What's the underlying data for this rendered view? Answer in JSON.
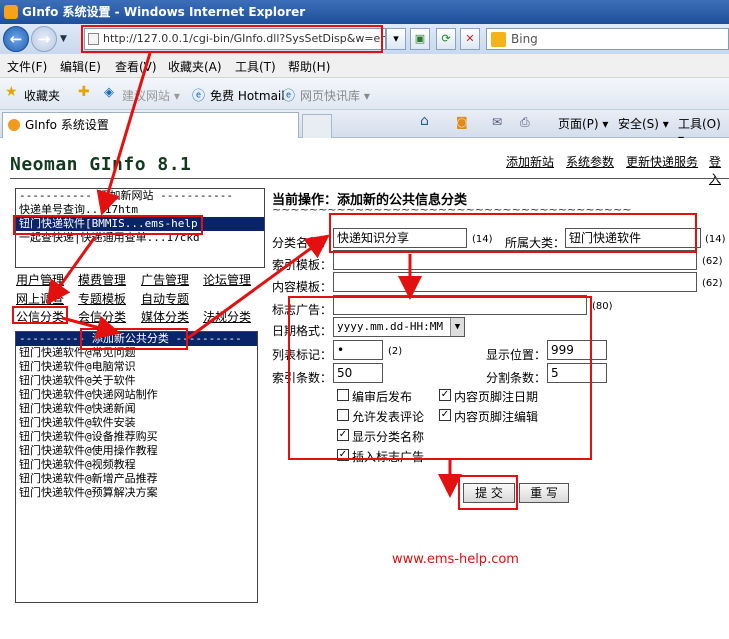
{
  "window": {
    "title": "GInfo 系统设置 - Windows Internet Explorer"
  },
  "address": {
    "url": "http://127.0.0.1/cgi-bin/GInfo.dll?SysSetDisp&w=ems-help",
    "search_placeholder": "Bing"
  },
  "menu": [
    "文件(F)",
    "编辑(E)",
    "查看(V)",
    "收藏夹(A)",
    "工具(T)",
    "帮助(H)"
  ],
  "favorites": {
    "label": "收藏夹",
    "items": [
      "建议网站 ▾",
      "免费 Hotmail",
      "网页快讯库 ▾"
    ]
  },
  "tab": {
    "title": "GInfo 系统设置"
  },
  "commands": {
    "page": "页面(P) ▾",
    "safety": "安全(S) ▾",
    "tools": "工具(O) ▾"
  },
  "brand": "Neoman GInfo 8.1",
  "top_links": [
    "添加新站",
    "系统参数",
    "更新快递服务",
    "登入"
  ],
  "site_list": [
    "----------- 添加新网站 -----------",
    "快递单号查询...17htm",
    "钮门快递软件[BMMIS...ems-help",
    "一起查快递|快递通用查单...17ckd"
  ],
  "nav_links": [
    [
      "用户管理",
      "模费管理",
      "广告管理",
      "论坛管理"
    ],
    [
      "网上调查",
      "专题模板",
      "自动专题",
      ""
    ],
    [
      "公信分类",
      "会信分类",
      "媒体分类",
      "法规分类"
    ]
  ],
  "category_list": [
    "---------- 添加新公共分类 ----------",
    "钮门快递软件@常见问题",
    "钮门快递软件@电脑常识",
    "钮门快递软件@关于软件",
    "钮门快递软件@快递网站制作",
    "钮门快递软件@快递新闻",
    "钮门快递软件@软件安装",
    "钮门快递软件@设备推荐购买",
    "钮门快递软件@使用操作教程",
    "钮门快递软件@视频教程",
    "钮门快递软件@新增产品推荐",
    "钮门快递软件@预算解决方案"
  ],
  "form": {
    "operation": "当前操作：添加新的公共信息分类",
    "tilde": "~~~~~~~~~~~~~~~~~~~~~~~~~~~~~~~~~~~~~~~",
    "name_label": "分类名称：",
    "name_value": "快递知识分享",
    "name_max": "(14)",
    "parent_label": "所属大类：",
    "parent_value": "钮门快递软件",
    "parent_max": "(14)",
    "index_tpl_label": "索引模板：",
    "index_tpl_max": "(62)",
    "content_tpl_label": "内容模板：",
    "content_tpl_max": "(62)",
    "ad_label": "标志广告：",
    "ad_max": "(80)",
    "date_label": "日期格式：",
    "date_value": "yyyy.mm.dd-HH:MM",
    "mark_label": "列表标记：",
    "mark_value": "•",
    "mark_max": "(2)",
    "position_label": "显示位置：",
    "position_value": "999",
    "index_count_label": "索引条数：",
    "index_count_value": "50",
    "split_label": "分割条数：",
    "split_value": "5",
    "checkboxes": [
      {
        "label": "编审后发布",
        "checked": false
      },
      {
        "label": "内容页脚注日期",
        "checked": true
      },
      {
        "label": "允许发表评论",
        "checked": false
      },
      {
        "label": "内容页脚注编辑",
        "checked": true
      },
      {
        "label": "显示分类名称",
        "checked": true
      },
      {
        "label": "插入标志广告",
        "checked": true
      }
    ],
    "submit": "提 交",
    "reset": "重 写"
  },
  "watermark": "www.ems-help.com",
  "accent": {
    "annotation_red": "#e31010",
    "selection_blue": "#0a246a"
  }
}
